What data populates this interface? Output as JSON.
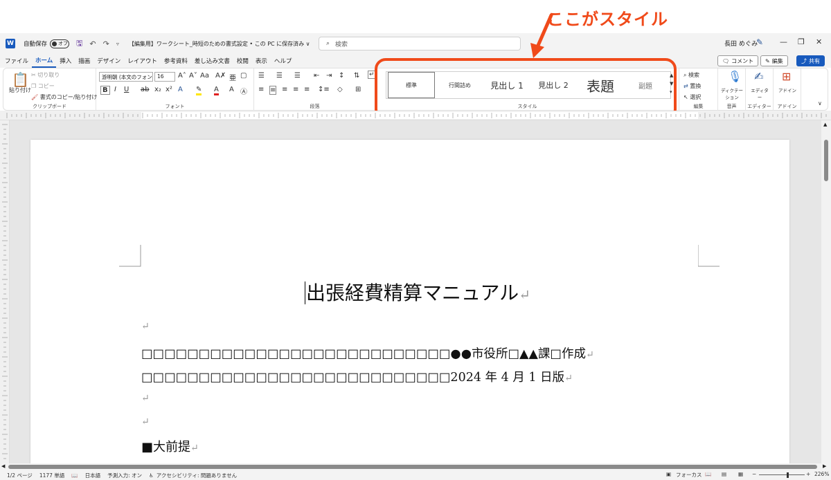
{
  "annotation": {
    "text": "ここがスタイル",
    "color": "#f04a1a"
  },
  "titlebar": {
    "app_icon": "W",
    "autosave_label": "自動保存",
    "autosave_toggle": "オフ",
    "doc_title": "【編集用】ワークシート_時短のための書式設定 • この PC に保存済み ∨",
    "search_placeholder": "検索",
    "user_name": "長田 めぐみ"
  },
  "menubar": {
    "items": [
      "ファイル",
      "ホーム",
      "挿入",
      "描画",
      "デザイン",
      "レイアウト",
      "参考資料",
      "差し込み文書",
      "校閲",
      "表示",
      "ヘルプ"
    ],
    "active": "ホーム",
    "comment_btn": "コメント",
    "edit_btn": "編集",
    "share_btn": "共有"
  },
  "ribbon": {
    "clipboard": {
      "label": "クリップボード",
      "paste": "貼り付け",
      "cut": "切り取り",
      "copy": "コピー",
      "format_painter": "書式のコピー/貼り付け"
    },
    "font": {
      "label": "フォント",
      "font_name": "游明朝 (本文のフォン",
      "font_size": "16"
    },
    "paragraph": {
      "label": "段落"
    },
    "styles": {
      "label": "スタイル",
      "items": [
        "標準",
        "行間詰め",
        "見出し 1",
        "見出し 2",
        "表題",
        "副題"
      ]
    },
    "editing": {
      "label": "編集",
      "find": "検索",
      "replace": "置換",
      "select": "選択"
    },
    "voice": {
      "label": "音声",
      "dictate": "ディクテーション"
    },
    "editor": {
      "label": "エディター",
      "editor": "エディター"
    },
    "addins": {
      "label": "アドイン",
      "addins": "アドイン"
    }
  },
  "document": {
    "title": "出張経費精算マニュアル",
    "line_author": "□□□□□□□□□□□□□□□□□□□□□□□□□□□●●市役所□▲▲課□作成",
    "line_date": "□□□□□□□□□□□□□□□□□□□□□□□□□□□2024 年 4 月 1 日版",
    "heading": "■大前提",
    "para_mark": "↵"
  },
  "statusbar": {
    "page": "1/2 ページ",
    "words": "1177 単語",
    "language": "日本語",
    "predict": "予測入力: オン",
    "accessibility": "アクセシビリティ: 問題ありません",
    "focus": "フォーカス",
    "zoom": "226%"
  }
}
